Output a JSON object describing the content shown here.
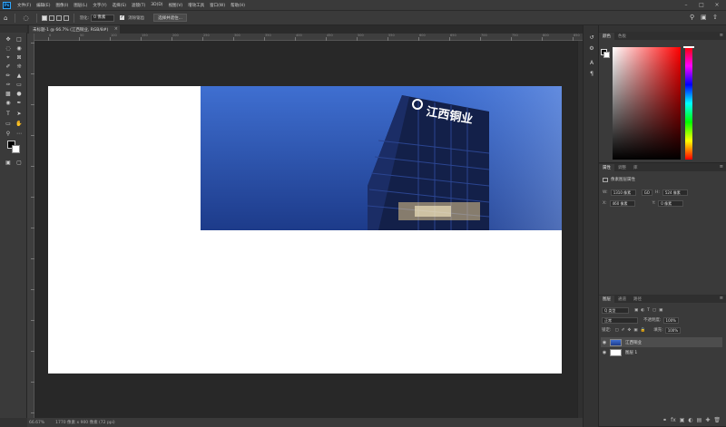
{
  "app": {
    "logo": "Ps"
  },
  "menu": [
    "文件(F)",
    "编辑(E)",
    "图像(I)",
    "图层(L)",
    "文字(Y)",
    "选择(S)",
    "滤镜(T)",
    "3D(D)",
    "视图(V)",
    "增效工具",
    "窗口(W)",
    "帮助(H)"
  ],
  "options": {
    "feather_label": "羽化:",
    "feather_value": "0 像素",
    "antialias_label": "消除锯齿",
    "select_mask_label": "选择并遮住..."
  },
  "document": {
    "tab_title": "未标题-1 @ 66.7% (江西铜业, RGB/8#)",
    "close": "×"
  },
  "ruler_numbers": [
    "0",
    "50",
    "100",
    "150",
    "200",
    "250",
    "300",
    "350",
    "400",
    "450",
    "500",
    "550",
    "600",
    "650",
    "700",
    "750",
    "800",
    "850"
  ],
  "building_sign": "江西铜业",
  "status": {
    "zoom": "66.67%",
    "doc_size": "1770 像素 x 900 像素 (72 ppi)"
  },
  "panels": {
    "color": {
      "tabs": [
        "颜色",
        "色板"
      ]
    },
    "properties": {
      "tabs": [
        "属性",
        "调整",
        "库"
      ],
      "title": "像素图层属性",
      "w_label": "W:",
      "w_value": "1310 像素",
      "go_label": "GO",
      "h_label": "H:",
      "h_value": "524 像素",
      "x_label": "X:",
      "x_value": "460 像素",
      "y_label": "Y:",
      "y_value": "0 像素"
    },
    "layers": {
      "tabs": [
        "图层",
        "通道",
        "路径"
      ],
      "filter_value": "Q 类型",
      "blend_mode": "正常",
      "opacity_label": "不透明度:",
      "opacity_value": "100%",
      "lock_label": "锁定:",
      "fill_label": "填充:",
      "fill_value": "100%",
      "items": [
        {
          "name": "江西铜业",
          "selected": true
        },
        {
          "name": "图层 1",
          "selected": false
        }
      ]
    }
  },
  "colors": {
    "accent": "#31a8ff",
    "sky_top": "#3f6fd1",
    "sky_bottom": "#1d3b8a"
  }
}
